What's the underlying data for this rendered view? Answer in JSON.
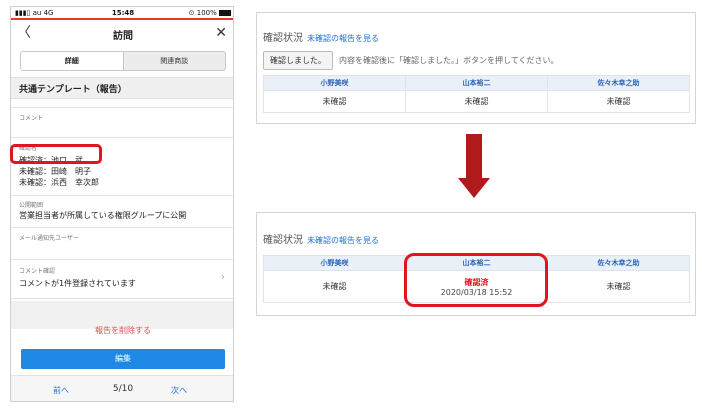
{
  "status_bar": {
    "carrier": "au  4G",
    "time": "15:48",
    "battery": "100%"
  },
  "nav": {
    "back_icon": "chevron-left-icon",
    "title": "訪問",
    "close_icon": "close-icon"
  },
  "tabs": [
    {
      "label": "詳細",
      "active": true
    },
    {
      "label": "関連商談",
      "active": false
    }
  ],
  "template_header": "共通テンプレート（報告）",
  "fields": {
    "comment_label": "コメント",
    "confirmer_label": "確認者",
    "confirmers": [
      "確認済：池口　武",
      "未確認：田崎　明子",
      "未確認：浜西　幸次郎"
    ],
    "scope_label": "公開範囲",
    "scope_value": "営業担当者が所属している権限グループに公開",
    "mail_label": "メール通知先ユーザー",
    "comment_confirm_label": "コメント確認",
    "comment_confirm_value": "コメントが1件登録されています"
  },
  "actions": {
    "delete": "報告を削除する",
    "edit": "編集"
  },
  "pager": {
    "prev": "前へ",
    "position": "5/10",
    "next": "次へ"
  },
  "panel_before": {
    "title": "確認状況",
    "link": "未確認の報告を見る",
    "ack_button": "確認しました。",
    "hint": "内容を確認後に「確認しました。」ボタンを押してください。",
    "headers": [
      "小野美咲",
      "山本裕二",
      "佐々木幸之助"
    ],
    "statuses": [
      "未確認",
      "未確認",
      "未確認"
    ]
  },
  "panel_after": {
    "title": "確認状況",
    "link": "未確認の報告を見る",
    "headers": [
      "小野美咲",
      "山本裕二",
      "佐々木幸之助"
    ],
    "statuses": [
      "未確認",
      "確認済",
      "未確認"
    ],
    "confirmed_timestamp": "2020/03/18 15:52"
  },
  "colors": {
    "accent_blue": "#1e88e5",
    "highlight_red": "#e0151f",
    "arrow_red": "#b01a1a",
    "header_blue_text": "#2a62b8"
  }
}
